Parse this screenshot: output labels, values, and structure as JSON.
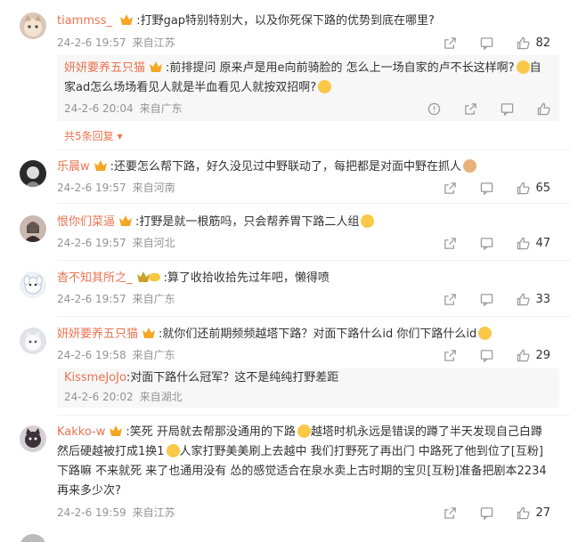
{
  "comments": [
    {
      "user": "tiammss_",
      "text": ":打野gap特别特别大，以及你死保下路的优势到底在哪里?",
      "time": "24-2-6 19:57",
      "source": "来自江苏",
      "likes": "82",
      "replies": [
        {
          "user": "妍妍要养五只猫",
          "text": ":前排提问 原来卢是用e向前骑脸的 怎么上一场自家的卢不长这样啊?",
          "text2": "家ad怎么场场看见人就是半血看见人就按双招啊?",
          "wrap_tail": "自",
          "time": "24-2-6 20:04",
          "source": "来自广东"
        }
      ],
      "more_replies": "共5条回复"
    },
    {
      "user": "乐晨w",
      "text": ":还要怎么帮下路，好久没见过中野联动了，每把都是对面中野在抓人",
      "time": "24-2-6 19:57",
      "source": "来自河南",
      "likes": "65"
    },
    {
      "user": "恨你们菜逼",
      "text": ":打野是就一根筋吗，只会帮养胃下路二人组",
      "time": "24-2-6 19:57",
      "source": "来自河北",
      "likes": "47"
    },
    {
      "user": "杳不知其所之_",
      "text": ":算了收拾收拾先过年吧，懒得喷",
      "time": "24-2-6 19:57",
      "source": "来自广东",
      "likes": "33"
    },
    {
      "user": "妍妍要养五只猫",
      "text": ":就你们还前期频频越塔下路？对面下路什么id 你们下路什么id",
      "time": "24-2-6 19:58",
      "source": "来自广东",
      "likes": "29",
      "replies": [
        {
          "user": "KissmeJoJo",
          "text": ":对面下路什么冠军？这不是纯纯打野差距",
          "time": "24-2-6 20:02",
          "source": "来自湖北"
        }
      ]
    },
    {
      "user": "Kakko-w",
      "text_lines": [
        ":笑死 开局就去帮那没通用的下路",
        "然后硬越被打成1换1",
        "下路嘛 不来就死 来了也通用没有 怂的感觉适合在泉水卖上古时期的宝贝[互粉]准备把剧本2234",
        "再来多少次?"
      ],
      "line1_tail": "越塔时机永远是错误的蹲了半天发现自己白蹲",
      "line2_tail": "人家打野美美刷上去越中 我们打野死了再出门 中路死了他到位了[互粉]",
      "time": "24-2-6 19:59",
      "source": "来自江苏",
      "likes": "27"
    }
  ],
  "colors": {
    "username": "#eb7350",
    "meta": "#939393",
    "reply_bg": "#f7f7f7"
  },
  "icons": [
    "share-icon",
    "comment-icon",
    "like-icon",
    "report-icon",
    "badge-icon",
    "chevron-down-icon"
  ]
}
